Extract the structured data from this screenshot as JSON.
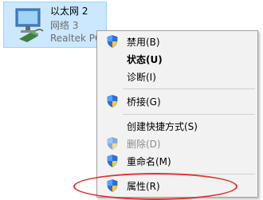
{
  "adapter": {
    "name": "以太网 2",
    "network": "网络 3",
    "device": "Realtek PCIe GbE Family Controller"
  },
  "context_menu": {
    "items": [
      {
        "label": "禁用(B)",
        "icon": "uac-shield-icon",
        "disabled": false
      },
      {
        "label": "状态(U)",
        "bold": true,
        "disabled": false
      },
      {
        "label": "诊断(I)",
        "disabled": false
      },
      {
        "label": "桥接(G)",
        "icon": "uac-shield-icon",
        "disabled": false
      },
      {
        "label": "创建快捷方式(S)",
        "disabled": false
      },
      {
        "label": "删除(D)",
        "icon": "uac-shield-icon",
        "disabled": true
      },
      {
        "label": "重命名(M)",
        "icon": "uac-shield-icon",
        "disabled": false
      },
      {
        "label": "属性(R)",
        "icon": "uac-shield-icon",
        "disabled": false,
        "annotated": true
      }
    ]
  },
  "colors": {
    "selection_bg": "#cce8ff",
    "annotation": "#e0332c",
    "menu_bg": "#f2f2f2"
  }
}
